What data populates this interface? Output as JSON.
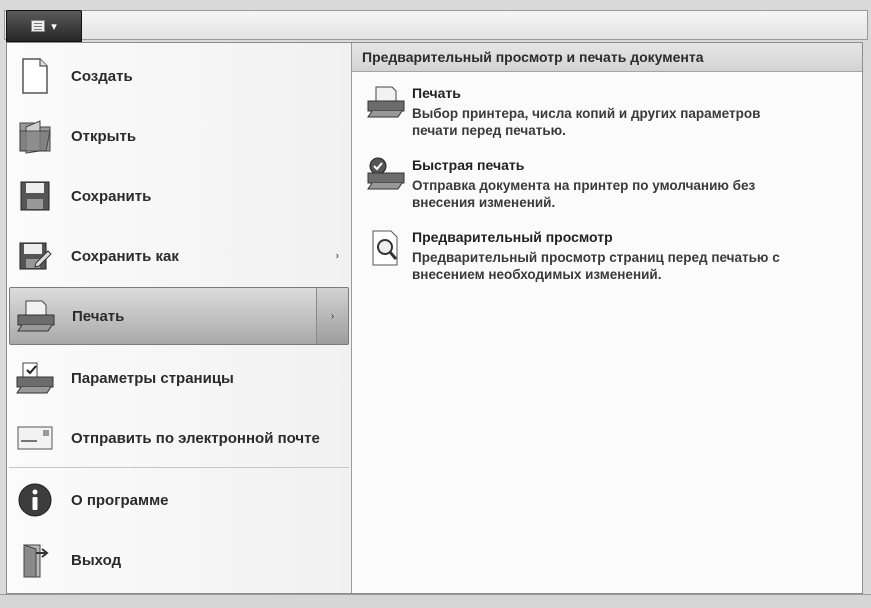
{
  "window": {
    "app_menu_button": "▤ ▾"
  },
  "menu": {
    "items": [
      {
        "label": "Создать",
        "icon": "new-document-icon"
      },
      {
        "label": "Открыть",
        "icon": "open-folder-icon"
      },
      {
        "label": "Сохранить",
        "icon": "save-icon"
      },
      {
        "label": "Сохранить как",
        "icon": "save-as-icon",
        "has_submenu": true
      },
      {
        "label": "Печать",
        "icon": "printer-icon",
        "has_submenu": true,
        "selected": true
      },
      {
        "label": "Параметры страницы",
        "icon": "page-setup-icon"
      },
      {
        "label": "Отправить по электронной почте",
        "icon": "email-icon"
      },
      {
        "label": "О программе",
        "icon": "info-icon"
      },
      {
        "label": "Выход",
        "icon": "exit-icon"
      }
    ],
    "arrow": "›"
  },
  "submenu": {
    "header": "Предварительный просмотр и печать документа",
    "options": [
      {
        "title": "Печать",
        "desc_line1": "Выбор принтера, числа копий и других параметров",
        "desc_line2": "печати перед печатью.",
        "icon": "printer-icon"
      },
      {
        "title": "Быстрая печать",
        "desc_line1": "Отправка документа на принтер по умолчанию без",
        "desc_line2": "внесения изменений.",
        "icon": "quick-print-icon"
      },
      {
        "title": "Предварительный просмотр",
        "desc_line1": "Предварительный просмотр страниц перед печатью с",
        "desc_line2": "внесением необходимых изменений.",
        "icon": "print-preview-icon"
      }
    ]
  }
}
